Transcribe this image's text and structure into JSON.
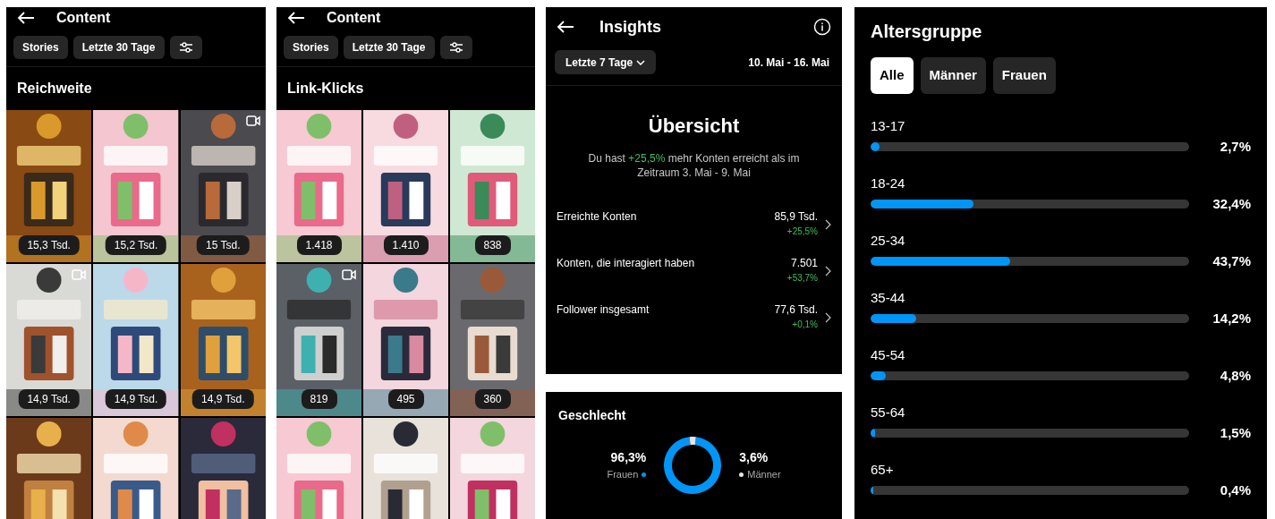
{
  "content_reach": {
    "title": "Content",
    "filters": [
      "Stories",
      "Letzte 30 Tage"
    ],
    "section": "Reichweite",
    "thumbnails": [
      {
        "count": "15,3 Tsd.",
        "video": false
      },
      {
        "count": "15,2 Tsd.",
        "video": false
      },
      {
        "count": "15 Tsd.",
        "video": true
      },
      {
        "count": "14,9 Tsd.",
        "video": true
      },
      {
        "count": "14,9 Tsd.",
        "video": false
      },
      {
        "count": "14,9 Tsd.",
        "video": false
      },
      {
        "video": false
      },
      {
        "video": false
      },
      {
        "video": false
      }
    ]
  },
  "content_clicks": {
    "title": "Content",
    "filters": [
      "Stories",
      "Letzte 30 Tage"
    ],
    "section": "Link-Klicks",
    "thumbnails": [
      {
        "count": "1.418",
        "video": false
      },
      {
        "count": "1.410",
        "video": false
      },
      {
        "count": "838",
        "video": false
      },
      {
        "count": "819",
        "video": true
      },
      {
        "count": "495",
        "video": false
      },
      {
        "count": "360",
        "video": false
      },
      {
        "video": false
      },
      {
        "video": false
      },
      {
        "video": false
      }
    ]
  },
  "insights": {
    "title": "Insights",
    "period": "Letzte 7 Tage",
    "date_range": "10. Mai - 16. Mai",
    "heading": "Übersicht",
    "summary": {
      "before": "Du hast ",
      "highlight": "+25,5%",
      "after": " mehr Konten erreicht als im Zeitraum 3. Mai - 9. Mai"
    },
    "metrics": [
      {
        "label": "Erreichte Konten",
        "value": "85,9 Tsd.",
        "change": "+25,5%"
      },
      {
        "label": "Konten, die interagiert haben",
        "value": "7.501",
        "change": "+53,7%"
      },
      {
        "label": "Follower insgesamt",
        "value": "77,6 Tsd.",
        "change": "+0,1%"
      }
    ]
  },
  "gender": {
    "title": "Geschlecht",
    "legend": [
      {
        "value": "96,3%",
        "color": "#0095f6"
      },
      {
        "value": "3,6%",
        "color": "#e5e5e5"
      }
    ],
    "chart_data": {
      "type": "donut",
      "categories": [
        "Frauen",
        "Männer"
      ],
      "values": [
        96.3,
        3.6
      ]
    }
  },
  "age": {
    "title": "Altersgruppe",
    "tabs": [
      {
        "label": "Alle",
        "selected": true
      },
      {
        "label": "Männer",
        "selected": false
      },
      {
        "label": "Frauen",
        "selected": false
      }
    ],
    "groups": [
      {
        "label": "13-17",
        "level": 0.027,
        "reading": "2,7%"
      },
      {
        "label": "18-24",
        "level": 0.324,
        "reading": "32,4%"
      },
      {
        "label": "25-34",
        "level": 0.437,
        "reading": "43,7%"
      },
      {
        "label": "35-44",
        "level": 0.142,
        "reading": "14,2%"
      },
      {
        "label": "45-54",
        "level": 0.048,
        "reading": "4,8%"
      },
      {
        "label": "55-64",
        "level": 0.015,
        "reading": "1,5%"
      },
      {
        "label": "65+",
        "level": 0.004,
        "reading": "0,4%"
      }
    ]
  }
}
